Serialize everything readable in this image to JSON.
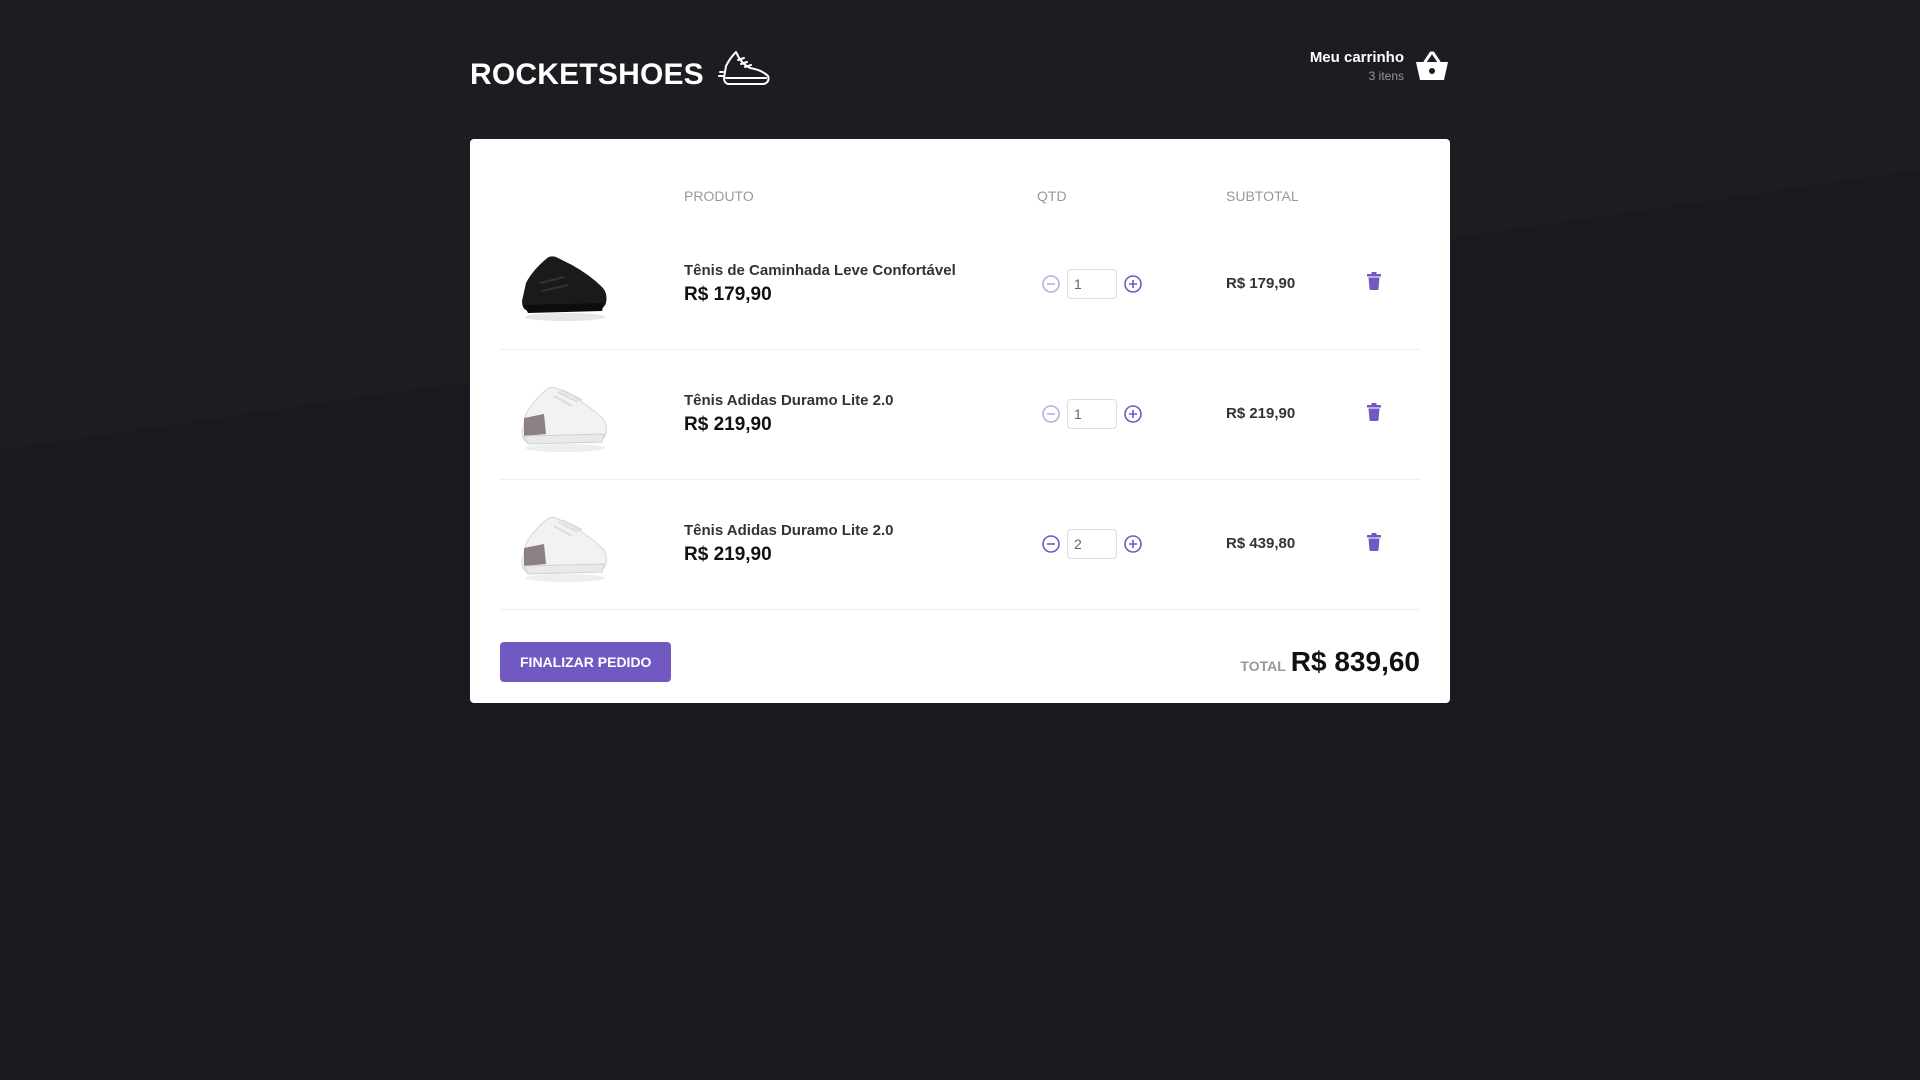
{
  "header": {
    "logo_text": "ROCKETSHOES",
    "cart_title": "Meu carrinho",
    "cart_count": "3 itens"
  },
  "table": {
    "col_product": "PRODUTO",
    "col_qty": "QTD",
    "col_subtotal": "SUBTOTAL"
  },
  "items": [
    {
      "title": "Tênis de Caminhada Leve Confortável",
      "price": "R$ 179,90",
      "qty": "1",
      "subtotal": "R$ 179,90",
      "image": "black-sneaker"
    },
    {
      "title": "Tênis Adidas Duramo Lite 2.0",
      "price": "R$ 219,90",
      "qty": "1",
      "subtotal": "R$ 219,90",
      "image": "white-sneaker"
    },
    {
      "title": "Tênis Adidas Duramo Lite 2.0",
      "price": "R$ 219,90",
      "qty": "2",
      "subtotal": "R$ 439,80",
      "image": "white-sneaker"
    }
  ],
  "footer": {
    "finish_label": "FINALIZAR PEDIDO",
    "total_label": "TOTAL",
    "total_value": "R$ 839,60"
  },
  "colors": {
    "background": "#191920",
    "accent": "#7159c1",
    "panel": "#ffffff"
  }
}
